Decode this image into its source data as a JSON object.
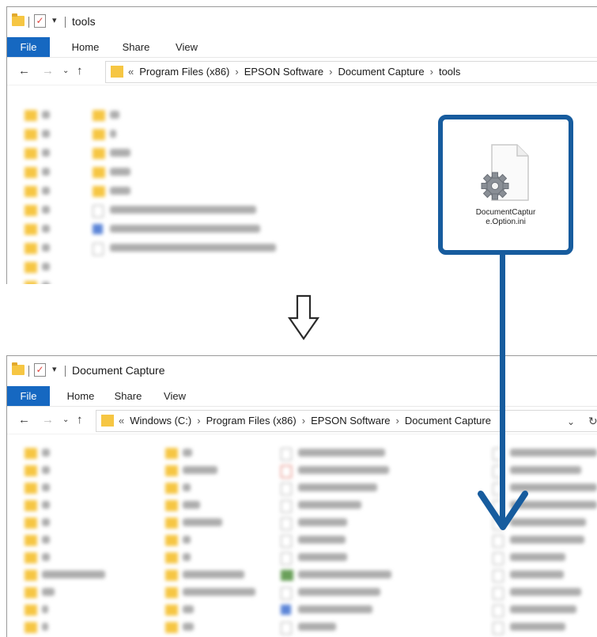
{
  "window_top": {
    "title": "tools",
    "ribbon_tabs": [
      "File",
      "Home",
      "Share",
      "View"
    ],
    "breadcrumb": [
      "Program Files (x86)",
      "EPSON Software",
      "Document Capture",
      "tools"
    ]
  },
  "highlight": {
    "file_name_line1": "DocumentCaptur",
    "file_name_line2": "e.Option.ini"
  },
  "window_bottom": {
    "title": "Document Capture",
    "ribbon_tabs": [
      "File",
      "Home",
      "Share",
      "View"
    ],
    "breadcrumb": [
      "Windows (C:)",
      "Program Files (x86)",
      "EPSON Software",
      "Document Capture"
    ]
  },
  "colors": {
    "accent_blue": "#175c9e",
    "ribbon_file": "#1668c1",
    "folder": "#f6c643"
  },
  "icons": [
    "folder-icon",
    "checkmark-icon",
    "back-arrow-icon",
    "forward-arrow-icon",
    "up-arrow-icon",
    "gear-file-icon",
    "down-arrow-icon",
    "refresh-icon"
  ]
}
